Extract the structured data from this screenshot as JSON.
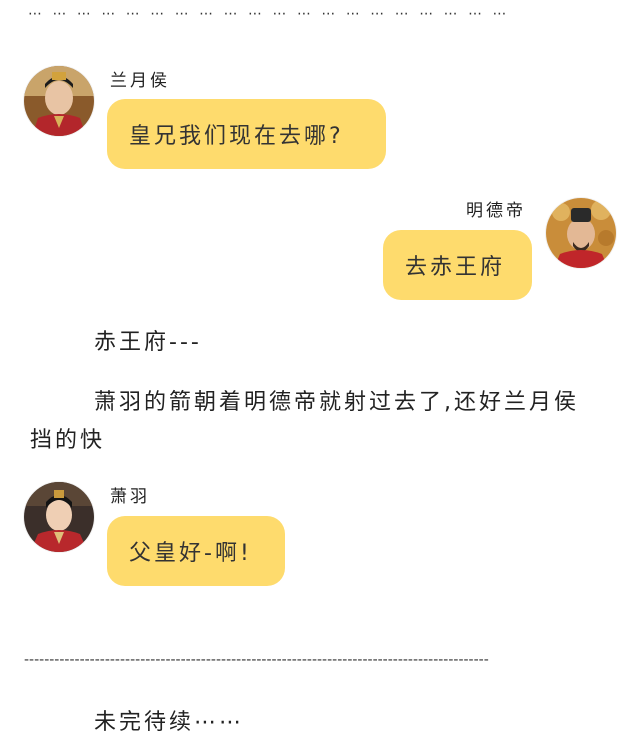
{
  "top_ellipsis": "⋯ ⋯ ⋯ ⋯ ⋯ ⋯ ⋯ ⋯ ⋯ ⋯ ⋯ ⋯ ⋯ ⋯ ⋯ ⋯ ⋯ ⋯ ⋯ ⋯",
  "messages": [
    {
      "speaker": "兰月侯",
      "text": "皇兄我们现在去哪?",
      "side": "left"
    },
    {
      "speaker": "明德帝",
      "text": "去赤王府",
      "side": "right"
    },
    {
      "speaker": "萧羽",
      "text": "父皇好-啊!",
      "side": "left"
    }
  ],
  "narration": [
    "赤王府---",
    "萧羽的箭朝着明德帝就射过去了,还好兰月侯挡的快"
  ],
  "separator": "--------------------------------------------------------------------------------------------",
  "ending": "未完待续⋯⋯",
  "colors": {
    "bubble": "#fedb6d",
    "text": "#222222"
  }
}
